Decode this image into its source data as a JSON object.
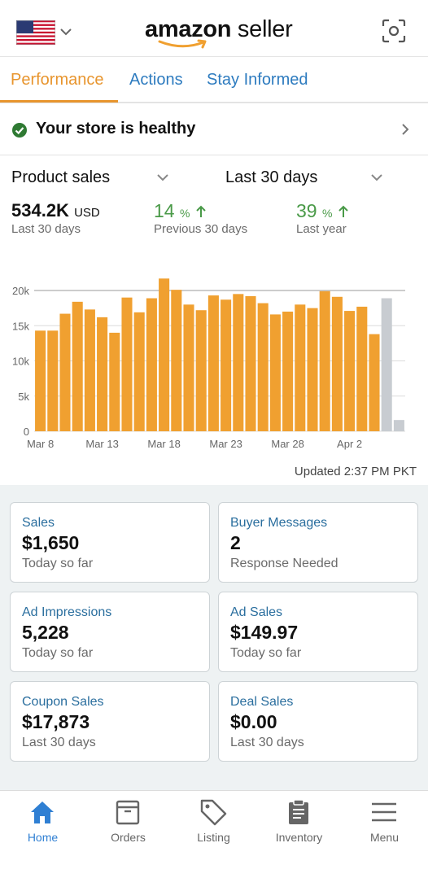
{
  "header": {
    "logo_bold": "amazon",
    "logo_light": " seller",
    "flag_icon": "us-flag-icon",
    "scan_icon": "scan-icon"
  },
  "tabs": [
    {
      "label": "Performance",
      "active": true
    },
    {
      "label": "Actions",
      "active": false
    },
    {
      "label": "Stay Informed",
      "active": false
    }
  ],
  "health": {
    "text": "Your store is healthy"
  },
  "summary": {
    "metric_select": "Product sales",
    "period_select": "Last 30 days",
    "total_value": "534.2K",
    "total_unit": "USD",
    "total_caption": "Last 30 days",
    "prev_value": "14",
    "prev_pct": "%",
    "prev_caption": "Previous 30 days",
    "year_value": "39",
    "year_pct": "%",
    "year_caption": "Last year"
  },
  "chart_data": {
    "type": "bar",
    "y_ticks": [
      "20k",
      "15k",
      "10k",
      "5k",
      "0"
    ],
    "x_ticks": [
      "Mar 8",
      "Mar 13",
      "Mar 18",
      "Mar 23",
      "Mar 28",
      "Apr 2"
    ],
    "ylim": [
      0,
      20000
    ],
    "values": [
      14300,
      14300,
      16700,
      18400,
      17300,
      16200,
      14000,
      19000,
      16900,
      18900,
      21700,
      20100,
      18000,
      17200,
      19300,
      18700,
      19500,
      19200,
      18200,
      16600,
      17000,
      18000,
      17500,
      19900,
      19100,
      17100,
      17700,
      13800,
      18900,
      1600
    ],
    "highlight_color": "#f0a030",
    "partial_color": "#c8ccd1",
    "partial_indices": [
      28,
      29
    ]
  },
  "updated": "Updated 2:37 PM PKT",
  "cards": [
    {
      "title": "Sales",
      "value": "$1,650",
      "sub": "Today so far"
    },
    {
      "title": "Buyer Messages",
      "value": "2",
      "sub": "Response Needed"
    },
    {
      "title": "Ad Impressions",
      "value": "5,228",
      "sub": "Today so far"
    },
    {
      "title": "Ad Sales",
      "value": "$149.97",
      "sub": "Today so far"
    },
    {
      "title": "Coupon Sales",
      "value": "$17,873",
      "sub": "Last 30 days"
    },
    {
      "title": "Deal Sales",
      "value": "$0.00",
      "sub": "Last 30 days"
    }
  ],
  "nav": [
    {
      "label": "Home",
      "icon": "home-icon",
      "active": true
    },
    {
      "label": "Orders",
      "icon": "box-icon",
      "active": false
    },
    {
      "label": "Listing",
      "icon": "tag-icon",
      "active": false
    },
    {
      "label": "Inventory",
      "icon": "clipboard-icon",
      "active": false
    },
    {
      "label": "Menu",
      "icon": "hamburger-icon",
      "active": false
    }
  ],
  "colors": {
    "accent": "#e8952e",
    "link": "#2d7bbf",
    "positive": "#4a9a48",
    "active_nav": "#2f7fd3"
  }
}
